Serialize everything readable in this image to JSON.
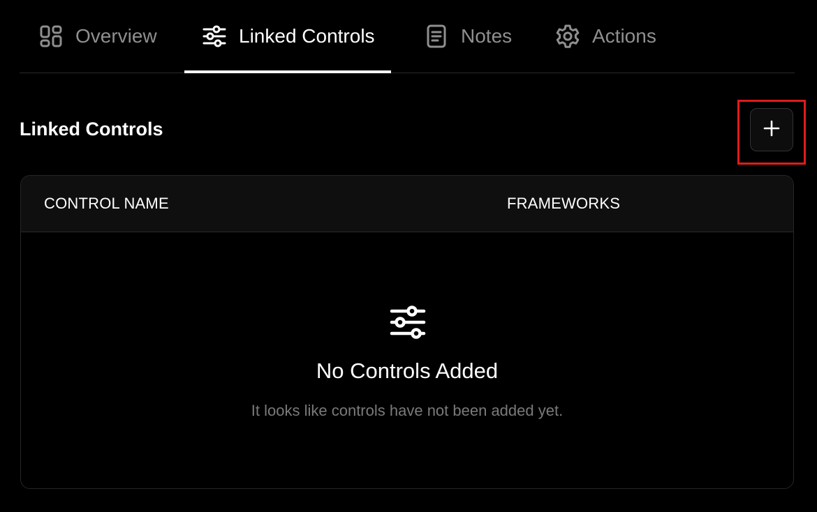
{
  "tabs": [
    {
      "label": "Overview",
      "icon": "layout-grid-icon",
      "active": false
    },
    {
      "label": "Linked Controls",
      "icon": "sliders-icon",
      "active": true
    },
    {
      "label": "Notes",
      "icon": "document-icon",
      "active": false
    },
    {
      "label": "Actions",
      "icon": "gear-icon",
      "active": false
    }
  ],
  "section": {
    "title": "Linked Controls",
    "add_icon": "plus-icon"
  },
  "table": {
    "columns": [
      "CONTROL NAME",
      "FRAMEWORKS"
    ],
    "rows": []
  },
  "empty_state": {
    "icon": "sliders-icon",
    "title": "No Controls Added",
    "subtitle": "It looks like controls have not been added yet."
  },
  "colors": {
    "background": "#000000",
    "active_text": "#ffffff",
    "inactive_text": "#8f8f8f",
    "highlight": "#e01b1b"
  }
}
